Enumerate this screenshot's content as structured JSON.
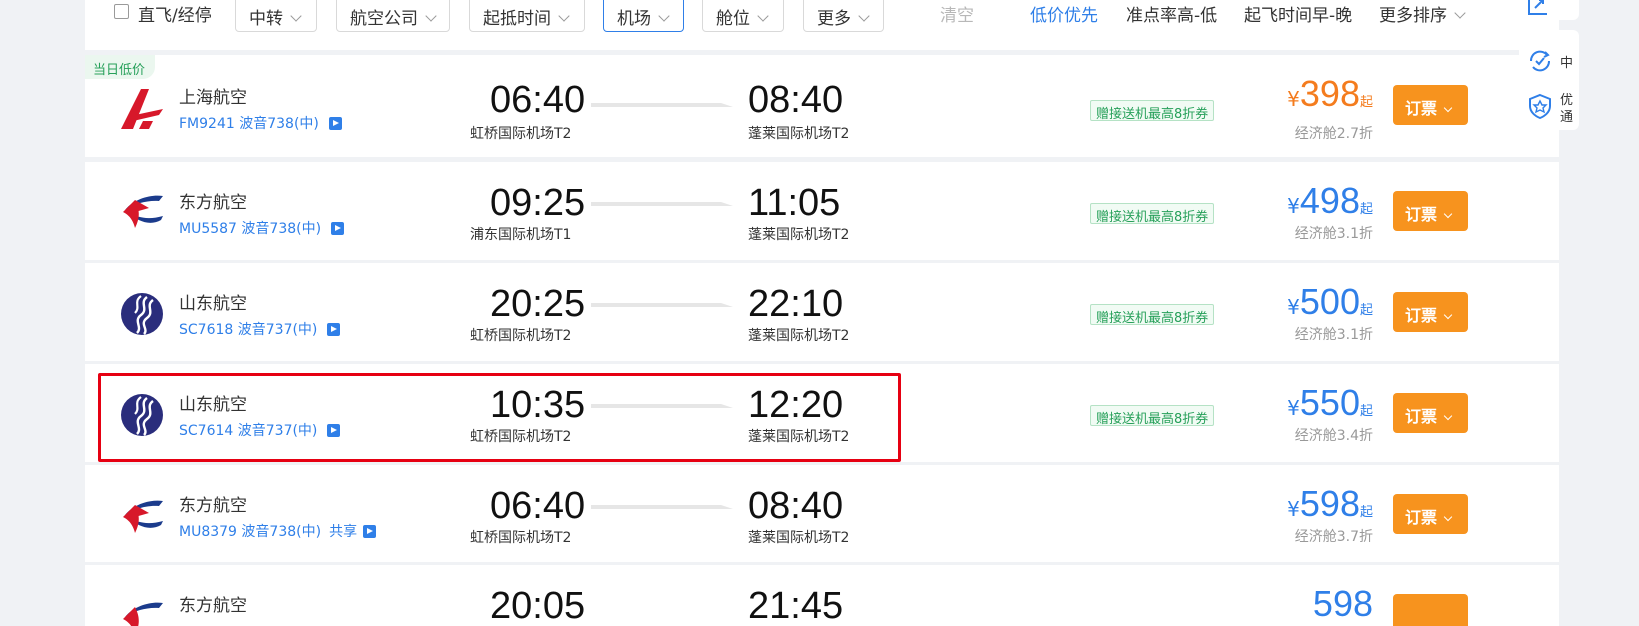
{
  "filters": {
    "direct_label": "直飞/经停",
    "dropdowns": [
      {
        "label": "中转",
        "active": false
      },
      {
        "label": "航空公司",
        "active": false
      },
      {
        "label": "起抵时间",
        "active": false
      },
      {
        "label": "机场",
        "active": true
      },
      {
        "label": "舱位",
        "active": false
      },
      {
        "label": "更多",
        "active": false
      }
    ],
    "clear_label": "清空"
  },
  "sort": {
    "items": [
      {
        "label": "低价优先",
        "active": true
      },
      {
        "label": "准点率高-低",
        "active": false
      },
      {
        "label": "起飞时间早-晚",
        "active": false
      },
      {
        "label": "更多排序",
        "active": false
      }
    ]
  },
  "side": {
    "item1_text": "中",
    "item2_text_a": "优",
    "item2_text_b": "通"
  },
  "flights": [
    {
      "tag": "当日低价",
      "airline": "上海航空",
      "logo": "shanghai-airlines-logo",
      "flight_no": "FM9241",
      "aircraft": "波音738(中)",
      "share": "",
      "dep_time": "06:40",
      "dep_airport": "虹桥国际机场T2",
      "arr_time": "08:40",
      "arr_airport": "蓬莱国际机场T2",
      "coupon": "赠接送机最高8折券",
      "currency": "¥",
      "price": "398",
      "price_suffix": "起",
      "price_color": "#f47c1e",
      "cabin": "经济舱2.7折",
      "book_label": "订票"
    },
    {
      "tag": "",
      "airline": "东方航空",
      "logo": "china-eastern-logo",
      "flight_no": "MU5587",
      "aircraft": "波音738(中)",
      "share": "",
      "dep_time": "09:25",
      "dep_airport": "浦东国际机场T1",
      "arr_time": "11:05",
      "arr_airport": "蓬莱国际机场T2",
      "coupon": "赠接送机最高8折券",
      "currency": "¥",
      "price": "498",
      "price_suffix": "起",
      "price_color": "#2f7fe8",
      "cabin": "经济舱3.1折",
      "book_label": "订票"
    },
    {
      "tag": "",
      "airline": "山东航空",
      "logo": "shandong-airlines-logo",
      "flight_no": "SC7618",
      "aircraft": "波音737(中)",
      "share": "",
      "dep_time": "20:25",
      "dep_airport": "虹桥国际机场T2",
      "arr_time": "22:10",
      "arr_airport": "蓬莱国际机场T2",
      "coupon": "赠接送机最高8折券",
      "currency": "¥",
      "price": "500",
      "price_suffix": "起",
      "price_color": "#2f7fe8",
      "cabin": "经济舱3.1折",
      "book_label": "订票"
    },
    {
      "tag": "",
      "airline": "山东航空",
      "logo": "shandong-airlines-logo",
      "flight_no": "SC7614",
      "aircraft": "波音737(中)",
      "share": "",
      "dep_time": "10:35",
      "dep_airport": "虹桥国际机场T2",
      "arr_time": "12:20",
      "arr_airport": "蓬莱国际机场T2",
      "coupon": "赠接送机最高8折券",
      "currency": "¥",
      "price": "550",
      "price_suffix": "起",
      "price_color": "#2f7fe8",
      "cabin": "经济舱3.4折",
      "book_label": "订票"
    },
    {
      "tag": "",
      "airline": "东方航空",
      "logo": "china-eastern-logo",
      "flight_no": "MU8379",
      "aircraft": "波音738(中)",
      "share": "共享",
      "dep_time": "06:40",
      "dep_airport": "虹桥国际机场T2",
      "arr_time": "08:40",
      "arr_airport": "蓬莱国际机场T2",
      "coupon": "",
      "currency": "¥",
      "price": "598",
      "price_suffix": "起",
      "price_color": "#2f7fe8",
      "cabin": "经济舱3.7折",
      "book_label": "订票"
    },
    {
      "tag": "",
      "airline": "东方航空",
      "logo": "china-eastern-logo",
      "flight_no": "",
      "aircraft": "",
      "share": "",
      "dep_time": "20:05",
      "dep_airport": "",
      "arr_time": "21:45",
      "arr_airport": "",
      "coupon": "",
      "currency": "",
      "price": "598",
      "price_suffix": "",
      "price_color": "#2f7fe8",
      "cabin": "",
      "book_label": ""
    }
  ]
}
